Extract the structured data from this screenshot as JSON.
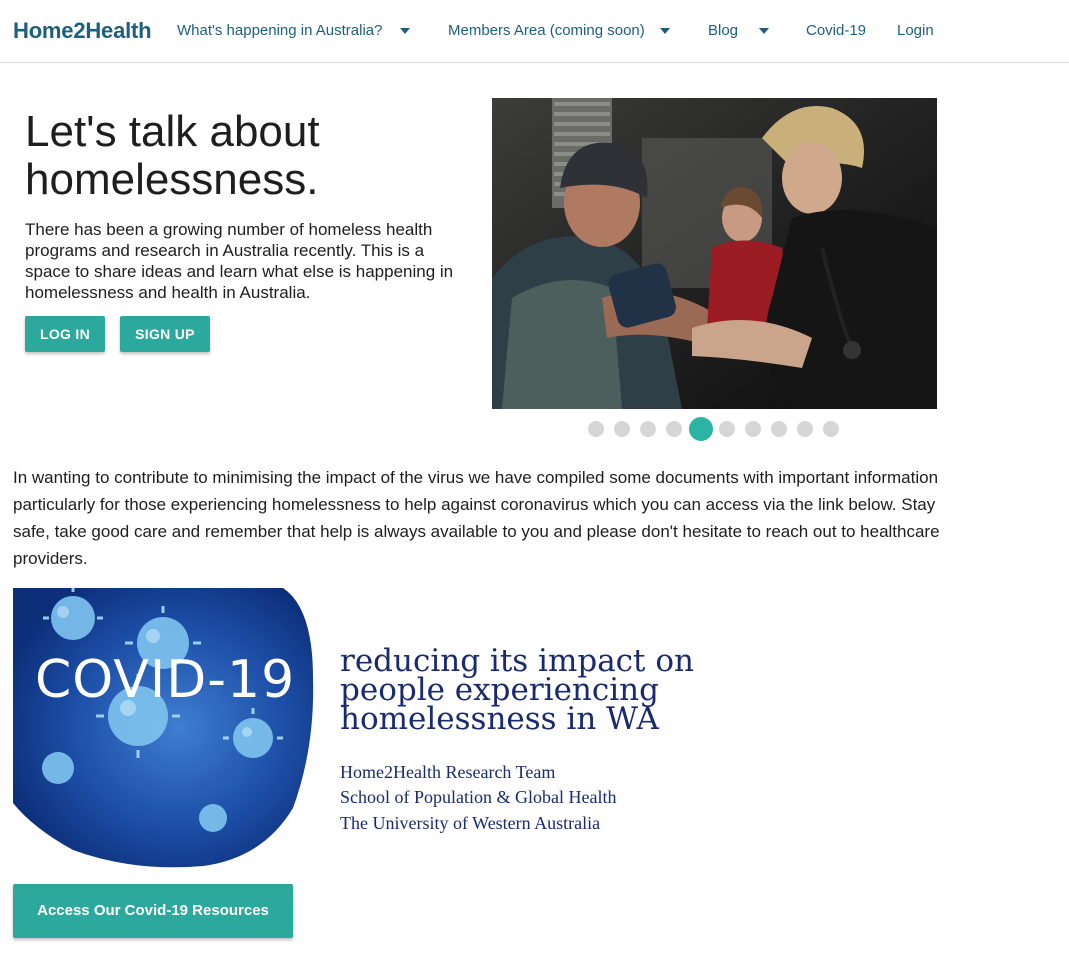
{
  "nav": {
    "brand": "Home2Health",
    "items": [
      {
        "label": "What's happening in Australia?",
        "has_dropdown": true
      },
      {
        "label": "Members Area (coming soon)",
        "has_dropdown": true
      },
      {
        "label": "Blog",
        "has_dropdown": true
      },
      {
        "label": "Covid-19",
        "has_dropdown": false
      },
      {
        "label": "Login",
        "has_dropdown": false
      }
    ]
  },
  "hero": {
    "title": "Let's talk about homelessness.",
    "text": "There has been a growing number of homeless health programs and research in Australia recently. This is a space to share ideas and learn what else is happening in homelessness and health in Australia.",
    "login_label": "LOG IN",
    "signup_label": "SIGN UP"
  },
  "carousel": {
    "slide_count": 10,
    "active_index": 4
  },
  "covid": {
    "paragraph": "In wanting to contribute to minimising the impact of the virus we have compiled some documents with important information particularly for those experiencing homelessness to help against coronavirus which you can access via the link below. Stay safe, take good care and remember that help is always available to you and please don't hesitate to reach out to healthcare providers.",
    "image_word": "COVID-19",
    "heading": "reducing its impact on people experiencing homelessness in WA",
    "team_lines": [
      "Home2Health Research Team",
      "School of Population & Global Health",
      "The University of Western Australia"
    ],
    "button_label": "Access Our Covid-19 Resources"
  },
  "colors": {
    "brand": "#1d5f7e",
    "accent": "#2da89c",
    "navy": "#1a2a6e"
  }
}
